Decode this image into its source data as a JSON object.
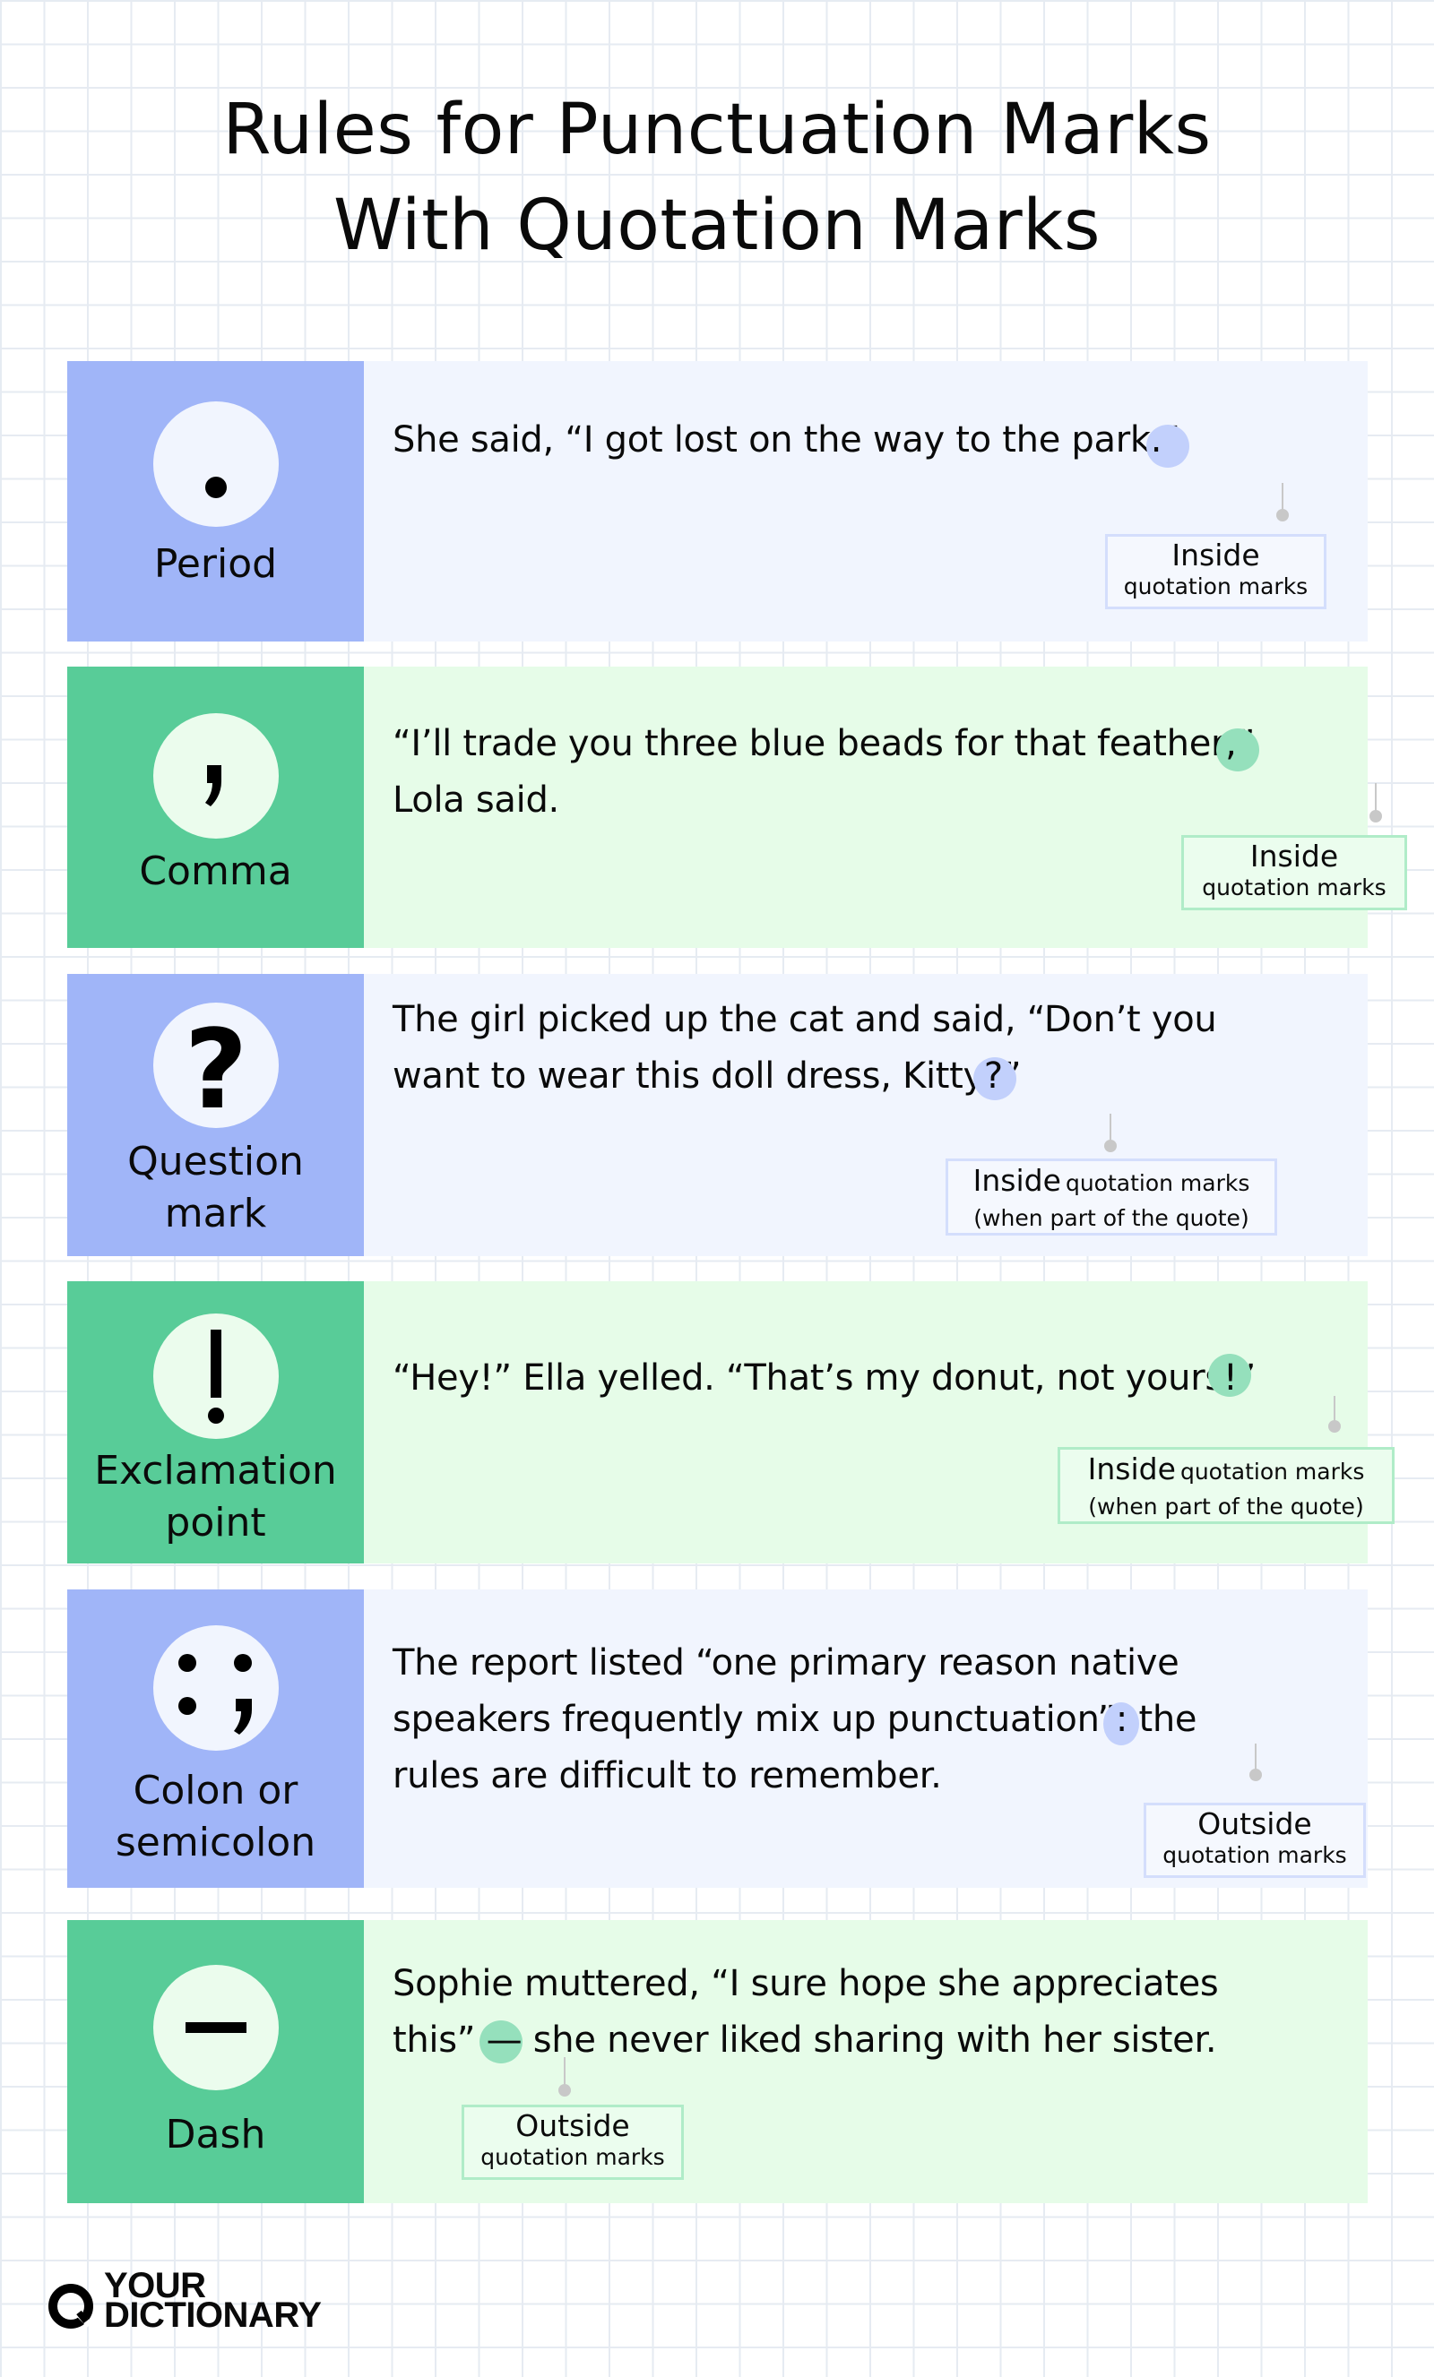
{
  "title": {
    "line1": "Rules for Punctuation Marks",
    "line2": "With Quotation Marks"
  },
  "colors": {
    "blue_side": "#a0b5f8",
    "blue_main": "#f1f5fe",
    "blue_highlight": "#c2d0fc",
    "green_side": "#58cc98",
    "green_main": "#e6fce8",
    "green_highlight": "#95e0bc",
    "grid": "#e6ebf2",
    "leader": "#c8c8c8"
  },
  "cards": [
    {
      "theme": "blue",
      "icon": "period-icon",
      "name_lines": [
        "Period"
      ],
      "sentence": {
        "before": "She said, “I got lost on the way to the park",
        "mark": ".",
        "after": "”"
      },
      "label": {
        "placement": "Inside",
        "detail": "quotation marks",
        "note": ""
      }
    },
    {
      "theme": "green",
      "icon": "comma-icon",
      "name_lines": [
        "Comma"
      ],
      "sentence": {
        "before": "“I’ll trade you three blue beads for that feather",
        "mark": ",",
        "after": "”\nLola said."
      },
      "label": {
        "placement": "Inside",
        "detail": "quotation marks",
        "note": ""
      }
    },
    {
      "theme": "blue",
      "icon": "question-mark-icon",
      "name_lines": [
        "Question",
        "mark"
      ],
      "sentence": {
        "before": "The girl picked up the cat and said, “Don’t you\nwant to wear this doll dress, Kitty",
        "mark": "?",
        "after": "”"
      },
      "label": {
        "placement": "Inside",
        "detail": "quotation marks",
        "note": "(when part of the quote)"
      }
    },
    {
      "theme": "green",
      "icon": "exclamation-point-icon",
      "name_lines": [
        "Exclamation",
        "point"
      ],
      "sentence": {
        "before": "“Hey!” Ella yelled. “That’s my donut, not yours",
        "mark": "!",
        "after": "”"
      },
      "label": {
        "placement": "Inside",
        "detail": "quotation marks",
        "note": "(when part of the quote)"
      }
    },
    {
      "theme": "blue",
      "icon": "colon-semicolon-icon",
      "name_lines": [
        "Colon or",
        "semicolon"
      ],
      "sentence": {
        "before": "The report listed “one primary reason native\nspeakers frequently mix up punctuation”",
        "mark": ":",
        "after": " the\nrules are difficult to remember."
      },
      "label": {
        "placement": "Outside",
        "detail": "quotation marks",
        "note": ""
      }
    },
    {
      "theme": "green",
      "icon": "dash-icon",
      "name_lines": [
        "Dash"
      ],
      "sentence": {
        "before": "Sophie muttered, “I sure hope she appreciates\nthis” ",
        "mark": "—",
        "after": " she never liked sharing with her sister."
      },
      "label": {
        "placement": "Outside",
        "detail": "quotation marks",
        "note": ""
      }
    }
  ],
  "logo": {
    "line1": "YOUR",
    "line2": "DICTIONARY"
  }
}
